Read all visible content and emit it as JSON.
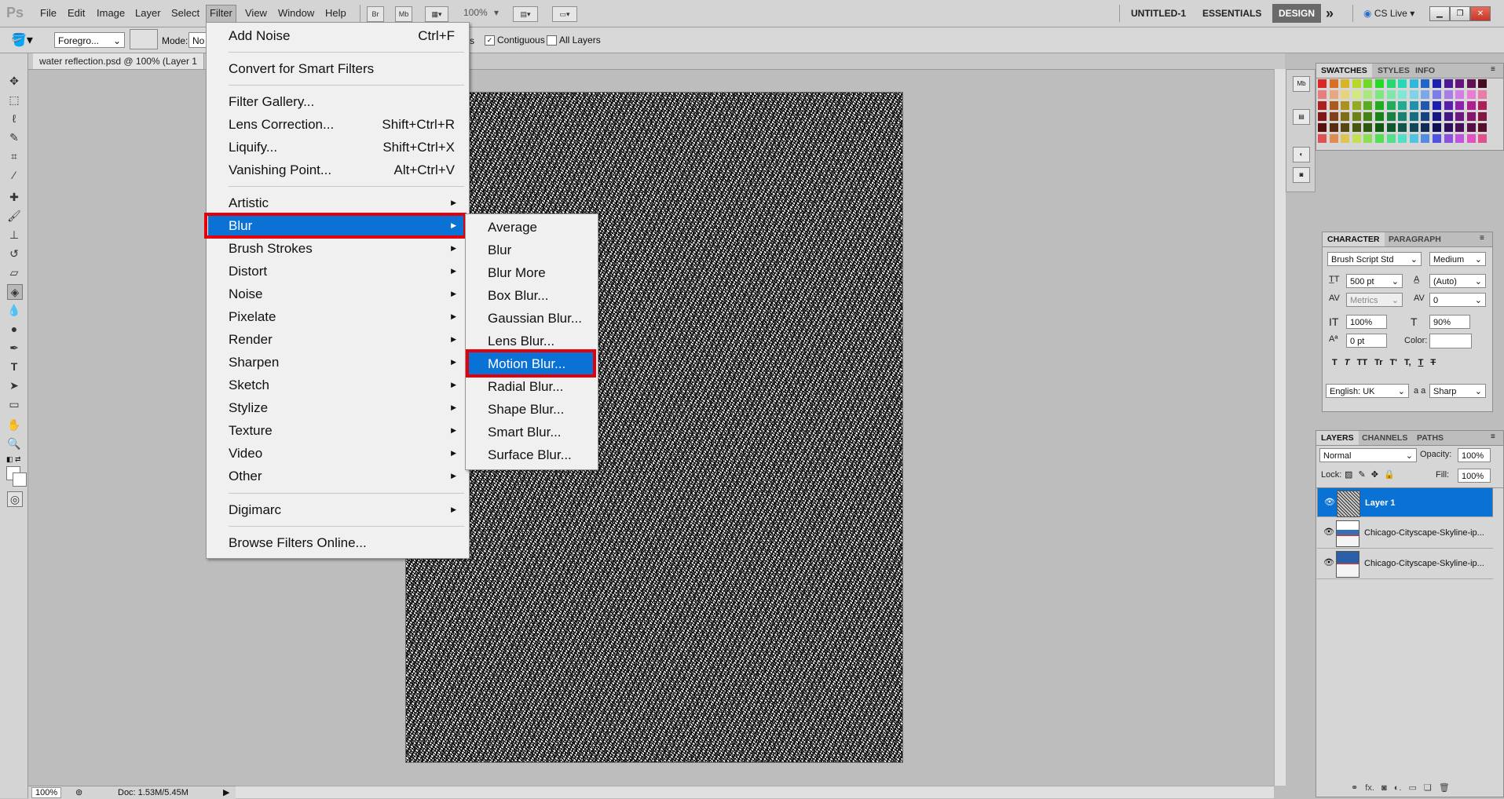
{
  "app": {
    "logo": "Ps"
  },
  "menubar": {
    "items": [
      "File",
      "Edit",
      "Image",
      "Layer",
      "Select",
      "Filter",
      "View",
      "Window",
      "Help"
    ],
    "mini_buttons": [
      "Br",
      "Mb"
    ],
    "zoom": "100%",
    "doc_title": "UNTITLED-1",
    "workspace_essentials": "ESSENTIALS",
    "workspace_design": "DESIGN",
    "more": "»",
    "cslive": "CS Live"
  },
  "options_bar": {
    "fill_source": "Foregro...",
    "mode_label": "Mode:",
    "mode_value": "No",
    "antialias_tail": "s",
    "contiguous": "Contiguous",
    "all_layers": "All Layers"
  },
  "document": {
    "tab_title": "water reflection.psd @ 100% (Layer 1"
  },
  "status": {
    "zoom": "100%",
    "doc": "Doc: 1.53M/5.45M"
  },
  "filter_menu": {
    "items": [
      {
        "label": "Add Noise",
        "shortcut": "Ctrl+F"
      },
      {
        "label": "Convert for Smart Filters"
      },
      {
        "label": "Filter Gallery..."
      },
      {
        "label": "Lens Correction...",
        "shortcut": "Shift+Ctrl+R"
      },
      {
        "label": "Liquify...",
        "shortcut": "Shift+Ctrl+X"
      },
      {
        "label": "Vanishing Point...",
        "shortcut": "Alt+Ctrl+V"
      },
      {
        "label": "Artistic"
      },
      {
        "label": "Blur"
      },
      {
        "label": "Brush Strokes"
      },
      {
        "label": "Distort"
      },
      {
        "label": "Noise"
      },
      {
        "label": "Pixelate"
      },
      {
        "label": "Render"
      },
      {
        "label": "Sharpen"
      },
      {
        "label": "Sketch"
      },
      {
        "label": "Stylize"
      },
      {
        "label": "Texture"
      },
      {
        "label": "Video"
      },
      {
        "label": "Other"
      },
      {
        "label": "Digimarc"
      },
      {
        "label": "Browse Filters Online..."
      }
    ]
  },
  "blur_menu": {
    "items": [
      "Average",
      "Blur",
      "Blur More",
      "Box Blur...",
      "Gaussian Blur...",
      "Lens Blur...",
      "Motion Blur...",
      "Radial Blur...",
      "Shape Blur...",
      "Smart Blur...",
      "Surface Blur..."
    ]
  },
  "swatches_panel": {
    "tabs": [
      "SWATCHES",
      "STYLES",
      "INFO"
    ]
  },
  "character_panel": {
    "tabs": [
      "CHARACTER",
      "PARAGRAPH"
    ],
    "font_family": "Brush Script Std",
    "font_style": "Medium",
    "font_size": "500 pt",
    "leading": "(Auto)",
    "kerning": "Metrics",
    "tracking": "0",
    "vertical_scale": "100%",
    "horizontal_scale": "90%",
    "baseline_shift": "0 pt",
    "color_label": "Color:",
    "style_buttons": [
      "T",
      "T",
      "TT",
      "Tr",
      "T'",
      "T,",
      "T",
      "T"
    ],
    "language": "English: UK",
    "aa_label": "a a",
    "antialias": "Sharp"
  },
  "layers_panel": {
    "tabs": [
      "LAYERS",
      "CHANNELS",
      "PATHS"
    ],
    "blend_mode": "Normal",
    "opacity_label": "Opacity:",
    "opacity": "100%",
    "lock_label": "Lock:",
    "fill_label": "Fill:",
    "fill": "100%",
    "layers": [
      {
        "name": "Layer 1",
        "selected": true
      },
      {
        "name": "Chicago-Cityscape-Skyline-ip...",
        "selected": false
      },
      {
        "name": "Chicago-Cityscape-Skyline-ip...",
        "selected": false
      }
    ]
  },
  "colors": {
    "highlight": "#0a72d4",
    "redbox": "#e3000b"
  }
}
